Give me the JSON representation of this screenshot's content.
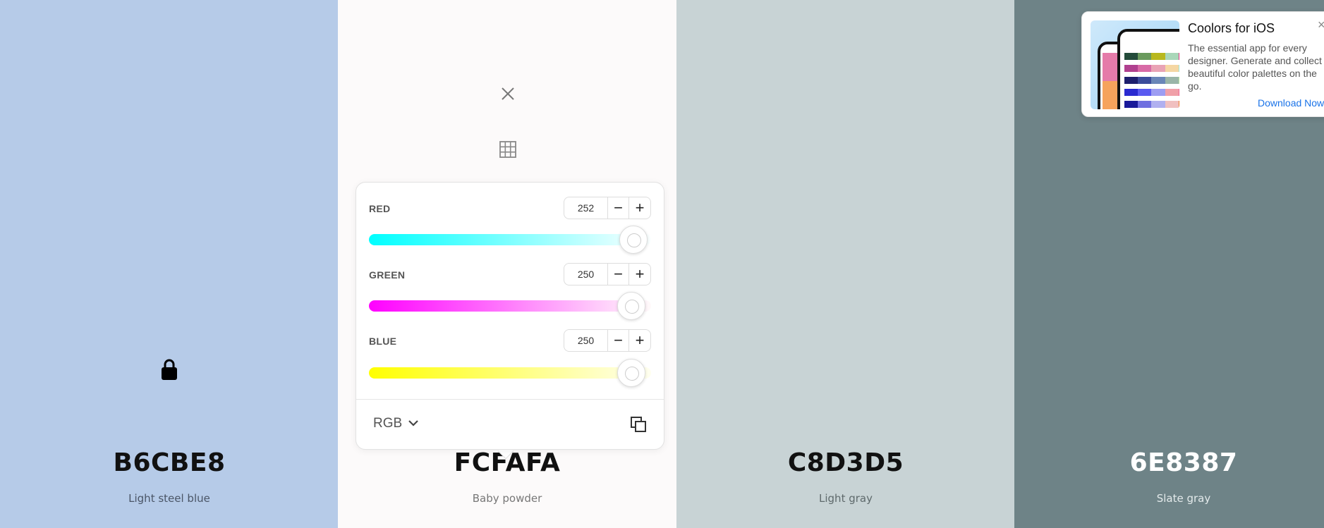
{
  "swatches": [
    {
      "hex": "B6CBE8",
      "name": "Light steel blue",
      "bg": "#B6CBE8",
      "text_color": "#111111",
      "name_color": "#4a5566"
    },
    {
      "hex": "FCFAFA",
      "name": "Baby powder",
      "bg": "#FCFAFA",
      "text_color": "#111111",
      "name_color": "#777777"
    },
    {
      "hex": "C8D3D5",
      "name": "Light gray",
      "bg": "#C8D3D5",
      "text_color": "#111111",
      "name_color": "#5f6a6c"
    },
    {
      "hex": "6E8387",
      "name": "Slate gray",
      "bg": "#6E8387",
      "text_color": "#ffffff",
      "name_color": "#e3eaeb"
    }
  ],
  "icons": {
    "lock": "lock-icon",
    "close": "close-icon",
    "grid": "grid-icon",
    "chevron": "chevron-down-icon",
    "copy": "copy-icon"
  },
  "picker": {
    "channels": [
      {
        "label": "RED",
        "value": "252",
        "level": 0.988,
        "gradient": "linear-gradient(to right, #00ffff, #fcffff)"
      },
      {
        "label": "GREEN",
        "value": "250",
        "level": 0.98,
        "gradient": "linear-gradient(to right, #ff00ff, #fffafa)"
      },
      {
        "label": "BLUE",
        "value": "250",
        "level": 0.98,
        "gradient": "linear-gradient(to right, #ffff00, #fffff0)"
      }
    ],
    "minus": "−",
    "plus": "+",
    "mode": "RGB"
  },
  "ad": {
    "title": "Coolors for iOS",
    "description": "The essential app for every designer. Generate and collect beautiful color palettes on the go.",
    "cta": "Download Now",
    "close": "×"
  }
}
